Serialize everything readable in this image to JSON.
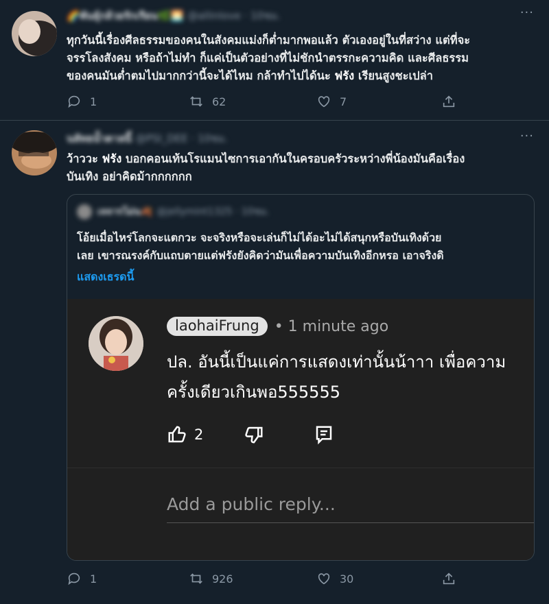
{
  "tweet1": {
    "name": "🌈พันธุ์กล้วยรักเรียน🌿🌅",
    "handle": "@allinlove · 10ชม.",
    "more": "···",
    "lines": [
      "ทุกวันนี้เรื่องศีลธรรมของคนในสังคมแม่งก็ต่ำมากพอแล้ว ตัวเองอยู่ในที่สว่าง แต่ที่จะ",
      "จรรโลงสังคม หรือถ้าไม่ทำ ก็แค่เป็นตัวอย่างที่ไม่ชักนำตรรกะความคิด และศีลธรรม",
      "ของคนมันต่ำตมไปมากกว่านี้จะได้ไหม กล้าทำไปได้นะ"
    ],
    "highlight": "ฟรัง",
    "line3_tail": " เรียนสูงชะเปล่า",
    "replies": "1",
    "retweets": "62",
    "likes": "7"
  },
  "tweet2": {
    "name": "นลัทธน้ำตาลนี้",
    "handle": "@PSI_DEE · 10ชม.",
    "more": "···",
    "line1_head": "ว้าววะ ",
    "highlight": "ฟรัง",
    "line1_tail": " บอกคอนเท้นโรแมนไซการเอากันในครอบครัวระหว่างพี่น้องมันคือเรื่อง",
    "line2": "บันเทิง อย่าคิดม้ากกกกกก",
    "replies": "1",
    "retweets": "926",
    "likes": "30"
  },
  "quote": {
    "name": "เจจารโม่น🍂",
    "handle": "@jellymint1325 · 10ชม.",
    "lines": [
      "โอ้ยเมื่อไหร่โลกจะแตกวะ จะจริงหรือจะเล่นก็ไม่ได้อะไม่ได้สนุกหรือบันเทิงด้วย",
      "เลย เขารณรงค์กับแถบตายแต่ฟรังยังคิดว่ามันเพื่อความบันเทิงอีกหรอ เอาจริงดิ"
    ],
    "show_thread": "แสดงเธรดนี้"
  },
  "youtube": {
    "author": "laohaiFrung",
    "time": "• 1 minute ago",
    "comment_lines": [
      "ปล. อันนี้เป็นแค่การแสดงเท่านั้นน้าาา เพื่อความ",
      "ครั้งเดียวเกินพอ555555"
    ],
    "like_count": "2",
    "reply_placeholder": "Add a public reply..."
  },
  "colors": {
    "background": "#15202b",
    "accent_link": "#1d9bf0",
    "muted": "#8b98a5",
    "youtube_bg": "#202020"
  }
}
